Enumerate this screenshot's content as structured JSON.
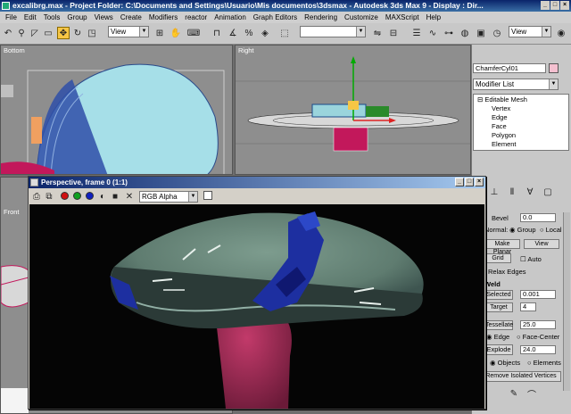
{
  "window": {
    "title": "excalibrg.max   - Project Folder: C:\\Documents and Settings\\Usuario\\Mis documentos\\3dsmax   - Autodesk 3ds Max 9   - Display : Dir..."
  },
  "menu": [
    "File",
    "Edit",
    "Tools",
    "Group",
    "Views",
    "Create",
    "Modifiers",
    "reactor",
    "Animation",
    "Graph Editors",
    "Rendering",
    "Customize",
    "MAXScript",
    "Help"
  ],
  "toolbar": {
    "ref_coord": "View",
    "view_dropdown2": "View"
  },
  "viewports": {
    "top_left": "Bottom",
    "top_right": "Right",
    "bottom_left": "Front"
  },
  "command_panel": {
    "object_name": "ChamferCyl01",
    "modifier_list": "Modifier List",
    "stack": [
      "Editable Mesh",
      "Vertex",
      "Edge",
      "Face",
      "Polygon",
      "Element"
    ],
    "bevel_label": "Bevel",
    "bevel_value": "0.0",
    "normal_label": "Normal:",
    "group_label": "Group",
    "local_label": "Local",
    "make_planar": "Make Planar",
    "view_label": "View",
    "grid_label": "Grid",
    "auto_label": "Auto",
    "relax_label": "Relax Edges",
    "weld_label": "Weld",
    "selected_label": "Selected",
    "selected_value": "0.001",
    "target_label": "Target",
    "target_value": "4",
    "tessellate_label": "Tessellate",
    "tessellate_value": "25.0",
    "edge_label": "Edge",
    "face_center_label": "Face-Center",
    "explode_label": "Explode",
    "explode_value": "24.0",
    "objects_label": "Objects",
    "elements_label": "Elements",
    "remove_isolated": "Remove Isolated Vertices"
  },
  "render_window": {
    "title": "Perspective, frame 0 (1:1)",
    "channel": "RGB Alpha",
    "colors": {
      "red": "#d01010",
      "green": "#10a020",
      "blue": "#1020c0"
    }
  }
}
